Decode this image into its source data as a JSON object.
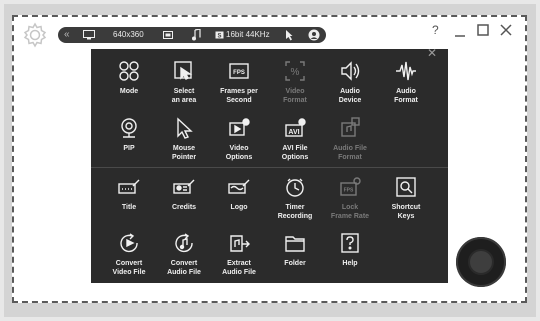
{
  "toolbar": {
    "collapse_icon": "double-chevron-left",
    "resolution": "640x360",
    "audio_format": "16bit 44KHz"
  },
  "menu_top": [
    {
      "id": "mode",
      "label": "Mode",
      "icon": "four-circles",
      "disabled": false
    },
    {
      "id": "select-area",
      "label": "Select\nan area",
      "icon": "crop-select",
      "disabled": false
    },
    {
      "id": "fps",
      "label": "Frames per\nSecond",
      "icon": "fps-box",
      "disabled": false
    },
    {
      "id": "video-format",
      "label": "Video\nFormat",
      "icon": "percent-box",
      "disabled": true
    },
    {
      "id": "audio-device",
      "label": "Audio\nDevice",
      "icon": "speaker",
      "disabled": false
    },
    {
      "id": "audio-format",
      "label": "Audio\nFormat",
      "icon": "waveform",
      "disabled": false
    },
    {
      "id": "pip",
      "label": "PIP",
      "icon": "webcam",
      "disabled": false
    },
    {
      "id": "mouse-pointer",
      "label": "Mouse\nPointer",
      "icon": "cursor",
      "disabled": false
    },
    {
      "id": "video-options",
      "label": "Video\nOptions",
      "icon": "video-gear",
      "disabled": false
    },
    {
      "id": "avi-file-options",
      "label": "AVI File\nOptions",
      "icon": "avi-gear",
      "disabled": false
    },
    {
      "id": "audio-file-format",
      "label": "Audio File\nFormat",
      "icon": "audio-file-gear",
      "disabled": true
    }
  ],
  "menu_bottom": [
    {
      "id": "title",
      "label": "Title",
      "icon": "title-edit",
      "disabled": false
    },
    {
      "id": "credits",
      "label": "Credits",
      "icon": "credits-edit",
      "disabled": false
    },
    {
      "id": "logo",
      "label": "Logo",
      "icon": "logo-edit",
      "disabled": false
    },
    {
      "id": "timer-recording",
      "label": "Timer\nRecording",
      "icon": "clock",
      "disabled": false
    },
    {
      "id": "lock-frame-rate",
      "label": "Lock\nFrame Rate",
      "icon": "fps-lock",
      "disabled": true
    },
    {
      "id": "shortcut-keys",
      "label": "Shortcut\nKeys",
      "icon": "magnifier-box",
      "disabled": false
    },
    {
      "id": "convert-video",
      "label": "Convert\nVideo File",
      "icon": "play-refresh",
      "disabled": false
    },
    {
      "id": "convert-audio",
      "label": "Convert\nAudio File",
      "icon": "note-refresh",
      "disabled": false
    },
    {
      "id": "extract-audio",
      "label": "Extract\nAudio File",
      "icon": "note-export",
      "disabled": false
    },
    {
      "id": "folder",
      "label": "Folder",
      "icon": "folder",
      "disabled": false
    },
    {
      "id": "help",
      "label": "Help",
      "icon": "question-box",
      "disabled": false
    }
  ]
}
